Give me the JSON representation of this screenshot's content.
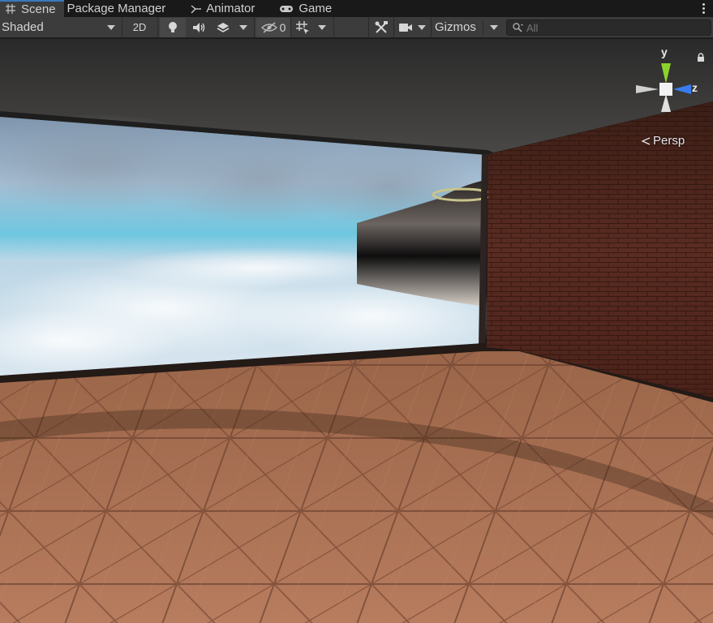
{
  "tabs": [
    {
      "label": "Scene",
      "icon": "grid-icon",
      "active": true
    },
    {
      "label": "Package Manager",
      "icon": "",
      "active": false
    },
    {
      "label": "Animator",
      "icon": "animator-icon",
      "active": false
    },
    {
      "label": "Game",
      "icon": "gamepad-icon",
      "active": false
    }
  ],
  "toolbar": {
    "draw_mode": "Shaded",
    "mode_2d": "2D",
    "hidden_count": "0",
    "gizmos": "Gizmos",
    "search_placeholder": "All"
  },
  "scene_gizmo": {
    "axis_y": "y",
    "axis_z": "z",
    "projection": "Persp",
    "colors": {
      "y": "#8bd32a",
      "z": "#3a7cf0",
      "neutral": "#e0e0e0"
    }
  },
  "colors": {
    "tab_active_accent": "#3a79bb",
    "toolbar_bg": "#3c3c3c",
    "tabbar_bg": "#191919"
  }
}
